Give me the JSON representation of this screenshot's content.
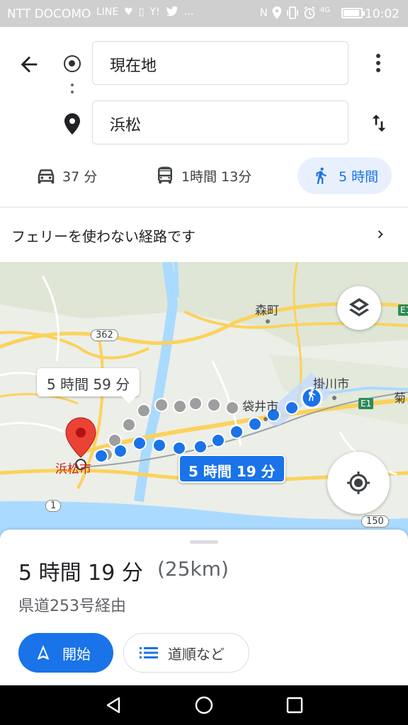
{
  "status_bar": {
    "carrier": "NTT DOCOMO",
    "time": "10:02",
    "signal": "4G",
    "left_icons": [
      "LINE",
      "♥",
      "▯",
      "Y!",
      "twitter",
      "…"
    ],
    "right_icons": [
      "N",
      "location",
      "vibrate",
      "alarm"
    ]
  },
  "directions": {
    "origin": "現在地",
    "destination": "浜松"
  },
  "modes": [
    {
      "name": "car-icon",
      "label": "37 分"
    },
    {
      "name": "bus-icon",
      "label": "1時間 13分"
    },
    {
      "name": "walk-icon",
      "label": "5 時間",
      "selected": true
    }
  ],
  "notice": {
    "text": "フェリーを使わない経路です"
  },
  "map": {
    "labels": {
      "morimachi": "森町",
      "kakegawa": "掛川市",
      "fukuroi": "袋井市",
      "hamamatsu": "浜松市",
      "kiku": "菊"
    },
    "shields": {
      "r362": "362",
      "r1": "1",
      "r150": "150",
      "e1": "E1",
      "e1b": "E1"
    },
    "alt_route_time": "5 時間 59 分",
    "route_time": "5 時間 19 分",
    "colors": {
      "route_active": "#1a73e8",
      "route_alt": "#9e9e9e",
      "road_major": "#fbd25a",
      "sea": "#aadaff",
      "river": "#aadaff",
      "pin": "#ea4335"
    }
  },
  "summary": {
    "duration": "5 時間 19 分",
    "distance": "(25km)",
    "via": "県道253号経由",
    "start_label": "開始",
    "steps_label": "道順など"
  }
}
